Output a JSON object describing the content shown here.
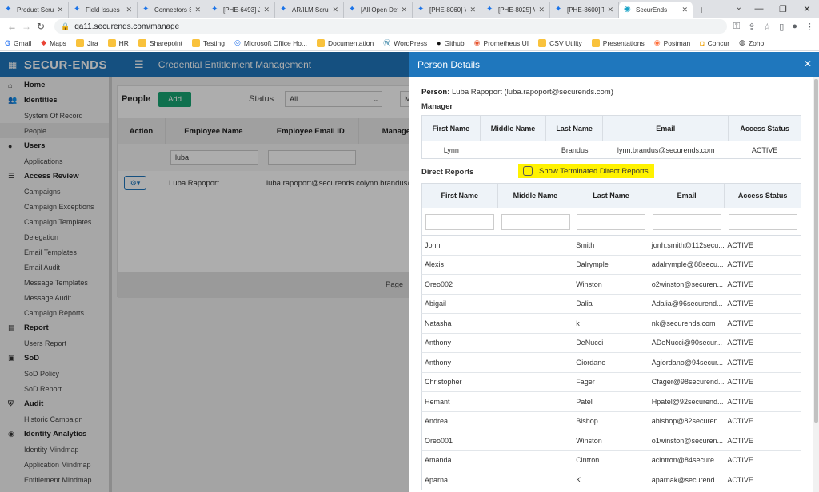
{
  "browser": {
    "tabs": [
      {
        "title": "Product Scrum",
        "active": false
      },
      {
        "title": "Field Issues Ka",
        "active": false
      },
      {
        "title": "Connectors Sc",
        "active": false
      },
      {
        "title": "[PHE-6493] Ji",
        "active": false
      },
      {
        "title": "AR/ILM Scrum",
        "active": false
      },
      {
        "title": "[All Open Defe",
        "active": false
      },
      {
        "title": "[PHE-8060] Va",
        "active": false
      },
      {
        "title": "[PHE-8025] Va",
        "active": false
      },
      {
        "title": "[PHE-8600] Ti",
        "active": false
      },
      {
        "title": "SecurEnds",
        "active": true
      }
    ],
    "url": "qa11.securends.com/manage",
    "bookmarks": [
      {
        "label": "Gmail",
        "icon": "gmail-icon"
      },
      {
        "label": "Maps",
        "icon": "maps-icon"
      },
      {
        "label": "Jira",
        "icon": "folder-icon"
      },
      {
        "label": "HR",
        "icon": "folder-icon"
      },
      {
        "label": "Sharepoint",
        "icon": "folder-icon"
      },
      {
        "label": "Testing",
        "icon": "folder-icon"
      },
      {
        "label": "Microsoft Office Ho...",
        "icon": "office-icon"
      },
      {
        "label": "Documentation",
        "icon": "folder-icon"
      },
      {
        "label": "WordPress",
        "icon": "wordpress-icon"
      },
      {
        "label": "Github",
        "icon": "github-icon"
      },
      {
        "label": "Prometheus UI",
        "icon": "prometheus-icon"
      },
      {
        "label": "CSV Utility",
        "icon": "folder-icon"
      },
      {
        "label": "Presentations",
        "icon": "folder-icon"
      },
      {
        "label": "Postman",
        "icon": "postman-icon"
      },
      {
        "label": "Concur",
        "icon": "concur-icon"
      },
      {
        "label": "Zoho",
        "icon": "zoho-icon"
      }
    ]
  },
  "app": {
    "logo": "SECUR-ENDS",
    "title": "Credential Entitlement Management"
  },
  "sidebar": {
    "sections": [
      {
        "label": "Home",
        "icon": "home-icon",
        "items": []
      },
      {
        "label": "Identities",
        "icon": "users-icon",
        "items": [
          "System Of Record",
          "People"
        ]
      },
      {
        "label": "Users",
        "icon": "user-icon",
        "items": [
          "Applications"
        ]
      },
      {
        "label": "Access Review",
        "icon": "review-icon",
        "items": [
          "Campaigns",
          "Campaign Exceptions",
          "Campaign Templates",
          "Delegation",
          "Email Templates",
          "Email Audit",
          "Message Templates",
          "Message Audit",
          "Campaign Reports"
        ]
      },
      {
        "label": "Report",
        "icon": "report-icon",
        "items": [
          "Users Report"
        ]
      },
      {
        "label": "SoD",
        "icon": "sod-icon",
        "items": [
          "SoD Policy",
          "SoD Report"
        ]
      },
      {
        "label": "Audit",
        "icon": "shield-icon",
        "items": [
          "Historic Campaign"
        ]
      },
      {
        "label": "Identity Analytics",
        "icon": "analytics-icon",
        "items": [
          "Identity Mindmap",
          "Application Mindmap",
          "Entitlement Mindmap"
        ]
      }
    ],
    "active_item": "People"
  },
  "people_panel": {
    "title": "People",
    "add_label": "Add",
    "status_label": "Status",
    "status_value": "All",
    "second_select_value": "Ma",
    "columns": [
      "Action",
      "Employee Name",
      "Employee Email ID",
      "Manager"
    ],
    "filter_value": "luba",
    "row": {
      "name": "Luba Rapoport",
      "email": "luba.rapoport@securends.cor",
      "manager": "lynn.brandus@"
    },
    "page_label": "Page"
  },
  "modal": {
    "title": "Person Details",
    "person_label": "Person:",
    "person_value": "Luba Rapoport (luba.rapoport@securends.com)",
    "manager_label": "Manager",
    "manager_columns": [
      "First Name",
      "Middle Name",
      "Last Name",
      "Email",
      "Access Status"
    ],
    "manager_row": {
      "first": "Lynn",
      "middle": "",
      "last": "Brandus",
      "email": "lynn.brandus@securends.com",
      "status": "ACTIVE"
    },
    "direct_reports_label": "Direct Reports",
    "show_terminated_label": "Show Terminated Direct Reports",
    "direct_columns": [
      "First Name",
      "Middle Name",
      "Last Name",
      "Email",
      "Access Status"
    ],
    "direct_reports": [
      {
        "first": "Jonh",
        "middle": "",
        "last": "Smith",
        "email": "jonh.smith@112secu...",
        "status": "ACTIVE"
      },
      {
        "first": "Alexis",
        "middle": "",
        "last": "Dalrymple",
        "email": "adalrymple@88secu...",
        "status": "ACTIVE"
      },
      {
        "first": "Oreo002",
        "middle": "",
        "last": "Winston",
        "email": "o2winston@securen...",
        "status": "ACTIVE"
      },
      {
        "first": "Abigail",
        "middle": "",
        "last": "Dalia",
        "email": "Adalia@96securend...",
        "status": "ACTIVE"
      },
      {
        "first": "Natasha",
        "middle": "",
        "last": "k",
        "email": "nk@securends.com",
        "status": "ACTIVE"
      },
      {
        "first": "Anthony",
        "middle": "",
        "last": "DeNucci",
        "email": "ADeNucci@90secur...",
        "status": "ACTIVE"
      },
      {
        "first": "Anthony",
        "middle": "",
        "last": "Giordano",
        "email": "Agiordano@94secur...",
        "status": "ACTIVE"
      },
      {
        "first": "Christopher",
        "middle": "",
        "last": "Fager",
        "email": "Cfager@98securend...",
        "status": "ACTIVE"
      },
      {
        "first": "Hemant",
        "middle": "",
        "last": "Patel",
        "email": "Hpatel@92securend...",
        "status": "ACTIVE"
      },
      {
        "first": "Andrea",
        "middle": "",
        "last": "Bishop",
        "email": "abishop@82securen...",
        "status": "ACTIVE"
      },
      {
        "first": "Oreo001",
        "middle": "",
        "last": "Winston",
        "email": "o1winston@securen...",
        "status": "ACTIVE"
      },
      {
        "first": "Amanda",
        "middle": "",
        "last": "Cintron",
        "email": "acintron@84secure...",
        "status": "ACTIVE"
      },
      {
        "first": "Aparna",
        "middle": "",
        "last": "K",
        "email": "aparnak@securend...",
        "status": "ACTIVE"
      }
    ]
  },
  "colors": {
    "brand": "#1f77bd",
    "add_button": "#17a673",
    "highlight": "#fff200"
  }
}
